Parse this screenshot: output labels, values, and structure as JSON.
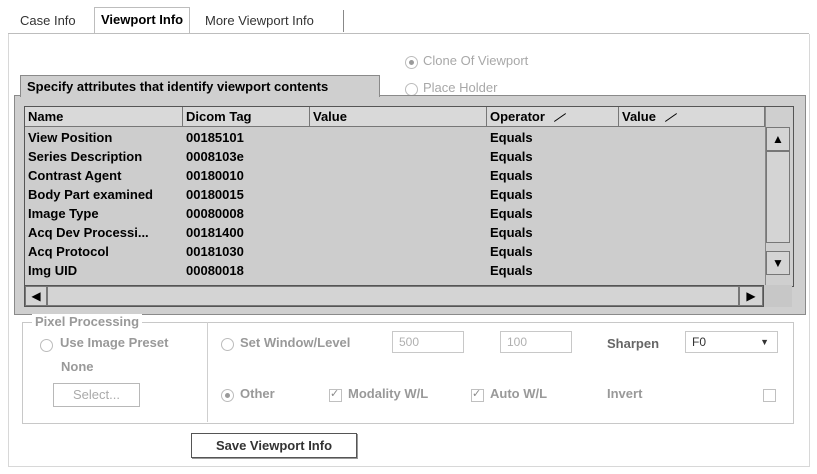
{
  "tabs": [
    {
      "label": "Case Info"
    },
    {
      "label": "Viewport Info"
    },
    {
      "label": "More Viewport Info"
    }
  ],
  "viewport_type": {
    "clone_label": "Clone Of Viewport",
    "placeholder_label": "Place Holder"
  },
  "attributes": {
    "title": "Specify attributes that identify viewport contents",
    "columns": [
      "Name",
      "Dicom Tag",
      "Value",
      "Operator",
      "Value"
    ],
    "rows": [
      {
        "name": "View Position",
        "tag": "00185101",
        "value": "",
        "operator": "Equals",
        "value2": ""
      },
      {
        "name": "Series Description",
        "tag": "0008103e",
        "value": "",
        "operator": "Equals",
        "value2": ""
      },
      {
        "name": "Contrast Agent",
        "tag": "00180010",
        "value": "",
        "operator": "Equals",
        "value2": ""
      },
      {
        "name": "Body Part examined",
        "tag": "00180015",
        "value": "",
        "operator": "Equals",
        "value2": ""
      },
      {
        "name": "Image Type",
        "tag": "00080008",
        "value": "",
        "operator": "Equals",
        "value2": ""
      },
      {
        "name": "Acq Dev Processi...",
        "tag": "00181400",
        "value": "",
        "operator": "Equals",
        "value2": ""
      },
      {
        "name": "Acq Protocol",
        "tag": "00181030",
        "value": "",
        "operator": "Equals",
        "value2": ""
      },
      {
        "name": "Img UID",
        "tag": "00080018",
        "value": "",
        "operator": "Equals",
        "value2": ""
      }
    ]
  },
  "pixel_processing": {
    "title": "Pixel Processing",
    "use_image_preset_label": "Use Image Preset",
    "preset_value": "None",
    "select_button": "Select...",
    "set_window_level_label": "Set Window/Level",
    "window_value": "500",
    "level_value": "100",
    "sharpen_label": "Sharpen",
    "sharpen_value": "F0",
    "other_label": "Other",
    "modality_wl_label": "Modality W/L",
    "auto_wl_label": "Auto W/L",
    "invert_label": "Invert"
  },
  "save_button": "Save Viewport Info"
}
